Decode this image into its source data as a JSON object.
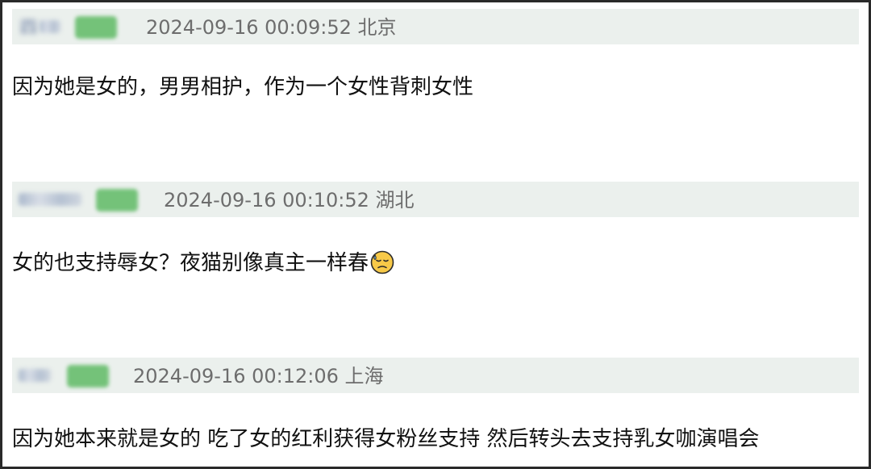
{
  "comments": [
    {
      "username": "四",
      "meta": "2024-09-16 00:09:52 北京",
      "text": "因为她是女的，男男相护，作为一个女性背刺女性"
    },
    {
      "username": "",
      "meta": "2024-09-16 00:10:52 湖北",
      "text": "女的也支持辱女？夜猫别像真主一样春",
      "emoji": "downcast-face-with-sweat"
    },
    {
      "username": "",
      "meta": "2024-09-16 00:12:06 上海",
      "text": "因为她本来就是女的 吃了女的红利获得女粉丝支持 然后转头去支持乳女咖演唱会"
    }
  ],
  "colors": {
    "header_bg": "#ebf0ed",
    "meta_text": "#6d6d6d",
    "badge": "#74c279",
    "username": "#5b6f9a",
    "border": "#2a2a2a"
  }
}
